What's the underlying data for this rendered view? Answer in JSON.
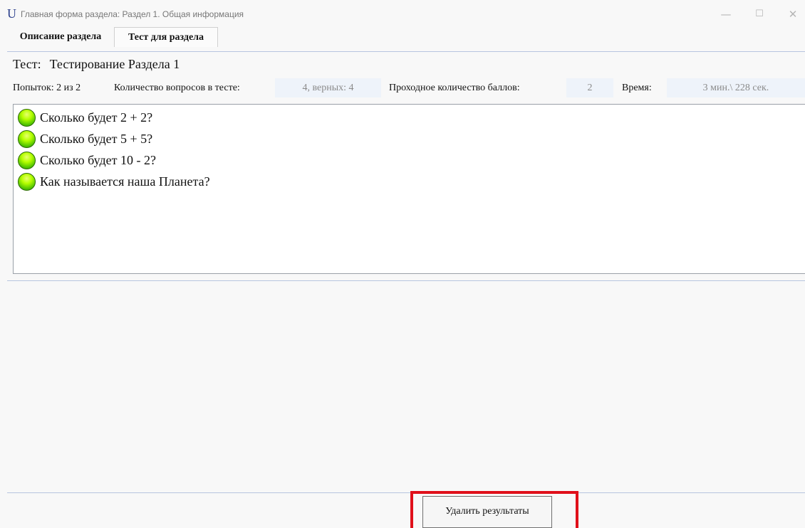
{
  "window": {
    "app_icon": "U",
    "title": "Главная форма раздела: Раздел 1. Общая информация",
    "minimize_glyph": "—",
    "maximize_glyph": "☐",
    "close_glyph": "✕"
  },
  "tabs": [
    {
      "label": "Описание раздела",
      "active": false
    },
    {
      "label": "Тест для раздела",
      "active": true
    }
  ],
  "test": {
    "label": "Тест:",
    "name": "Тестирование Раздела 1",
    "attempts_label": "Попыток: 2 из 2",
    "questions_label": "Количество вопросов в тесте:",
    "questions_value": "4, верных: 4",
    "passing_label": "Проходное количество баллов:",
    "passing_value": "2",
    "time_label": "Время:",
    "time_value": "3 мин.\\ 228 сек."
  },
  "questions": [
    {
      "text": "Сколько будет 2 + 2?",
      "status": "green-dot-icon"
    },
    {
      "text": "Сколько будет 5 + 5?",
      "status": "green-dot-icon"
    },
    {
      "text": "Сколько будет 10 - 2?",
      "status": "green-dot-icon"
    },
    {
      "text": "Как называется наша Планета?",
      "status": "green-dot-icon"
    }
  ],
  "actions": {
    "delete_results_label": "Удалить результаты"
  },
  "colors": {
    "highlight_frame": "#e0101a",
    "separator": "#b7c5df",
    "value_box": "#eef3fa"
  }
}
